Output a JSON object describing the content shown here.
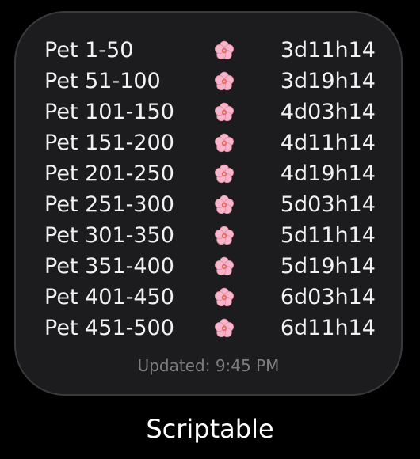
{
  "widget": {
    "rows": [
      {
        "label": "Pet 1-50",
        "time": "3d11h14"
      },
      {
        "label": "Pet 51-100",
        "time": "3d19h14"
      },
      {
        "label": "Pet 101-150",
        "time": "4d03h14"
      },
      {
        "label": "Pet 151-200",
        "time": "4d11h14"
      },
      {
        "label": "Pet 201-250",
        "time": "4d19h14"
      },
      {
        "label": "Pet 251-300",
        "time": "5d03h14"
      },
      {
        "label": "Pet 301-350",
        "time": "5d11h14"
      },
      {
        "label": "Pet 351-400",
        "time": "5d19h14"
      },
      {
        "label": "Pet 401-450",
        "time": "6d03h14"
      },
      {
        "label": "Pet 451-500",
        "time": "6d11h14"
      }
    ],
    "row_icon": "cherry-blossom-icon",
    "updated": "Updated: 9:45 PM"
  },
  "app_name": "Scriptable",
  "colors": {
    "background": "#000000",
    "widget_background": "#1c1c1e",
    "text": "#f2f2f2",
    "muted_text": "#7d7d80",
    "blossom": "#f7b6c9"
  }
}
